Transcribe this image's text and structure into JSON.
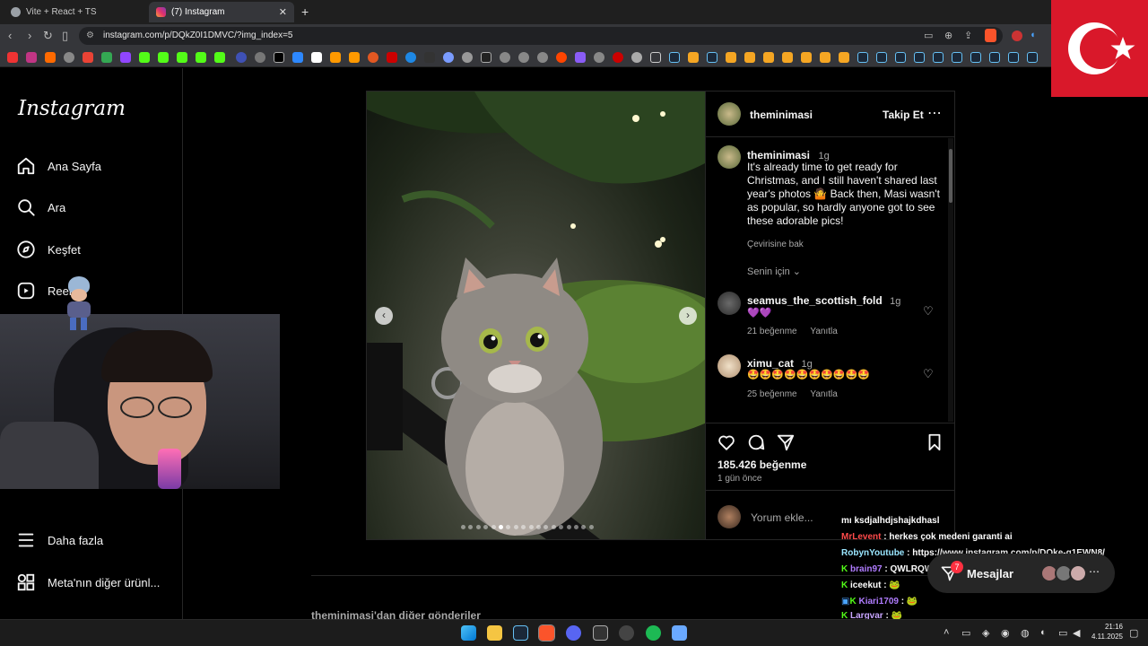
{
  "browser": {
    "tabs": [
      {
        "title": "Vite + React + TS",
        "active": false
      },
      {
        "title": "(7) Instagram",
        "active": true
      }
    ],
    "new_tab": "+",
    "url": "instagram.com/p/DQkZ0I1DMVC/?img_index=5"
  },
  "sidebar": {
    "logo": "Instagram",
    "items": [
      {
        "label": "Ana Sayfa",
        "icon": "home-icon"
      },
      {
        "label": "Ara",
        "icon": "search-icon"
      },
      {
        "label": "Keşfet",
        "icon": "explore-icon"
      },
      {
        "label": "Reels",
        "icon": "reels-icon"
      }
    ],
    "bottom": [
      {
        "label": "Daha fazla",
        "icon": "menu-icon"
      },
      {
        "label": "Meta'nın diğer ürünl...",
        "icon": "meta-apps-icon"
      }
    ]
  },
  "post": {
    "author": "theminimasi",
    "follow": "Takip Et",
    "caption_user": "theminimasi",
    "caption_time": "1g",
    "caption_text": "It's already time to get ready for Christmas, and I still haven't shared last year's photos 🤷 Back then, Masi wasn't as popular, so hardly anyone got to see these adorable pics!",
    "translate": "Çevirisine bak",
    "filter": "Senin için",
    "comments": [
      {
        "user": "seamus_the_scottish_fold",
        "time": "1g",
        "text": "💜💜",
        "likes": "21 beğenme",
        "reply": "Yanıtla"
      },
      {
        "user": "ximu_cat",
        "time": "1g",
        "text": "🤩🤩🤩🤩🤩🤩🤩🤩🤩🤩",
        "likes": "25 beğenme",
        "reply": "Yanıtla"
      }
    ],
    "like_count": "185.426 beğenme",
    "posted": "1 gün önce",
    "comment_placeholder": "Yorum ekle...",
    "carousel_dots": 18,
    "carousel_active_index": 5
  },
  "more_posts": "theminimasi'dan diğer gönderiler",
  "chat": [
    {
      "user": "MrLevent",
      "text": "herkes çok medeni garanti ai",
      "color": "#ff4b4b"
    },
    {
      "user": "RobynYoutube",
      "text": "https://www.instagram.com/p/DQke-q1EWN8/",
      "color": "#9ae6ff"
    },
    {
      "user": "brain97",
      "text": "QWLRQWÜTWQT",
      "color": "#b07cff"
    },
    {
      "user": "iceekut",
      "text": "🐸",
      "color": "#ffffff"
    },
    {
      "user": "Kiari1709",
      "text": "🐸",
      "color": "#b07cff"
    },
    {
      "user": "Largvar",
      "text": "🐸",
      "color": "#c9a6ff"
    }
  ],
  "chat_partial_top": "mı ksdjalhdjshajkdhasl",
  "messages": {
    "label": "Mesajlar",
    "badge": "7"
  },
  "taskbar": {
    "time": "21:16",
    "date": "4.11.2025"
  },
  "colors": {
    "accent": "#0095f6",
    "follow": "#4f77e8",
    "flag_red": "#d9182a"
  }
}
